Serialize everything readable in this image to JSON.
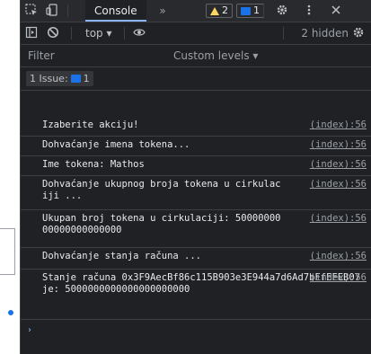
{
  "tabs": {
    "console": "Console",
    "overflow": "»"
  },
  "badges": {
    "warnings": "2",
    "messages": "1"
  },
  "context": {
    "selected": "top ▾"
  },
  "hidden": "2 hidden",
  "filter": {
    "placeholder": "Filter"
  },
  "levels": "Custom levels ▾",
  "issues": {
    "label": "1 Issue:",
    "count": "1"
  },
  "log": [
    {
      "text": "Izaberite akciju!",
      "source": "(index):56"
    },
    {
      "text": "Dohvaćanje imena tokena...",
      "source": "(index):56"
    },
    {
      "text": "Ime tokena: Mathos",
      "source": "(index):56"
    },
    {
      "text": "Dohvaćanje ukupnog broja tokena u cirkulaciji ...",
      "source": "(index):56"
    },
    {
      "text": "Ukupan broj tokena u cirkulaciji: 5000000000000000000000",
      "source": "(index):56"
    },
    {
      "text": "Dohvaćanje stanja računa ...",
      "source": "(index):56"
    },
    {
      "text": "Stanje računa 0x3F9AecBf86c115B903e3E944a7d6Ad7bFfEFEB07 je: 5000000000000000000000",
      "source": "(index):56"
    }
  ],
  "prompt": "›",
  "colors": {
    "background": "#202124",
    "text": "#e8eaed",
    "link": "#9aa0a6",
    "accent": "#8ab4f8",
    "warning": "#fdd663",
    "info": "#1a73e8"
  }
}
